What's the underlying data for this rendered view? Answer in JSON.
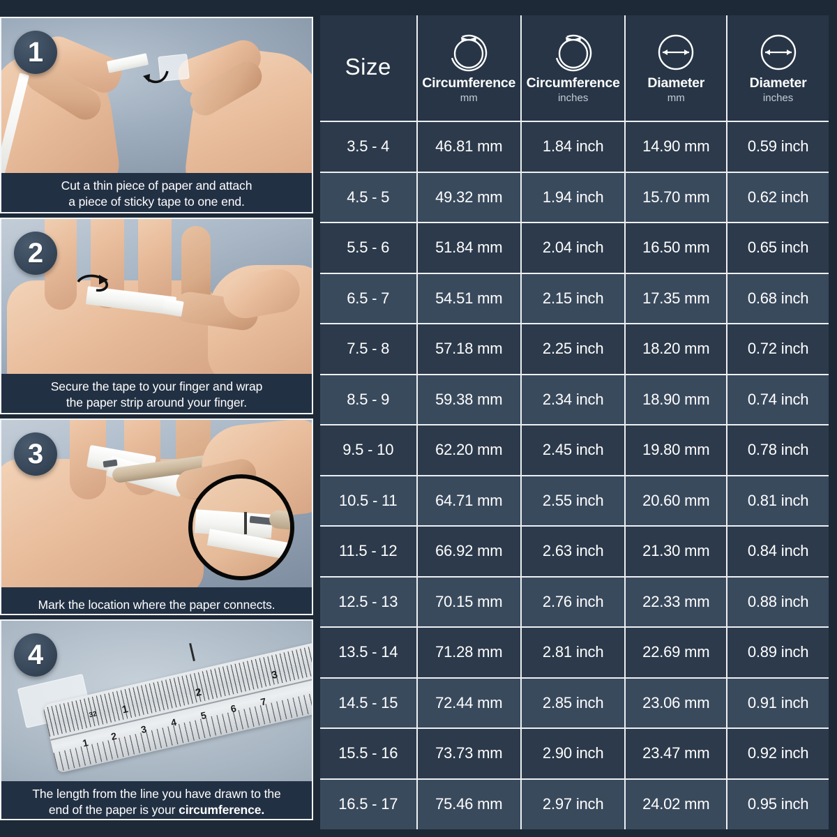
{
  "steps": [
    {
      "number": "1",
      "caption_lines": [
        "Cut a thin piece of paper and attach",
        "a piece of sticky tape to one end."
      ],
      "scene": "two-hands-paper-tape"
    },
    {
      "number": "2",
      "caption_lines": [
        "Secure the tape to your finger and wrap",
        "the paper strip around your finger."
      ],
      "scene": "hand-wrap-finger"
    },
    {
      "number": "3",
      "caption_lines": [
        "Mark the location where the paper connects."
      ],
      "scene": "pen-mark-magnifier"
    },
    {
      "number": "4",
      "caption_lines": [
        "The length from the line you have drawn to the",
        "end of the paper is your "
      ],
      "caption_bold": "circumference.",
      "scene": "ruler-measure"
    }
  ],
  "table": {
    "headers": [
      {
        "title": "Size",
        "unit": "",
        "icon": "none"
      },
      {
        "title": "Circumference",
        "unit": "mm",
        "icon": "circumference-ring-icon"
      },
      {
        "title": "Circumference",
        "unit": "inches",
        "icon": "circumference-ring-icon"
      },
      {
        "title": "Diameter",
        "unit": "mm",
        "icon": "diameter-arrow-icon"
      },
      {
        "title": "Diameter",
        "unit": "inches",
        "icon": "diameter-arrow-icon"
      }
    ],
    "rows": [
      [
        "3.5 - 4",
        "46.81 mm",
        "1.84 inch",
        "14.90 mm",
        "0.59 inch"
      ],
      [
        "4.5 - 5",
        "49.32 mm",
        "1.94 inch",
        "15.70 mm",
        "0.62 inch"
      ],
      [
        "5.5 - 6",
        "51.84 mm",
        "2.04 inch",
        "16.50 mm",
        "0.65 inch"
      ],
      [
        "6.5 - 7",
        "54.51 mm",
        "2.15 inch",
        "17.35 mm",
        "0.68 inch"
      ],
      [
        "7.5 - 8",
        "57.18 mm",
        "2.25 inch",
        "18.20 mm",
        "0.72 inch"
      ],
      [
        "8.5 - 9",
        "59.38 mm",
        "2.34 inch",
        "18.90 mm",
        "0.74 inch"
      ],
      [
        "9.5 - 10",
        "62.20 mm",
        "2.45 inch",
        "19.80 mm",
        "0.78 inch"
      ],
      [
        "10.5 - 11",
        "64.71 mm",
        "2.55 inch",
        "20.60 mm",
        "0.81 inch"
      ],
      [
        "11.5 - 12",
        "66.92 mm",
        "2.63 inch",
        "21.30 mm",
        "0.84 inch"
      ],
      [
        "12.5 - 13",
        "70.15 mm",
        "2.76 inch",
        "22.33 mm",
        "0.88 inch"
      ],
      [
        "13.5 - 14",
        "71.28 mm",
        "2.81 inch",
        "22.69 mm",
        "0.89 inch"
      ],
      [
        "14.5 - 15",
        "72.44 mm",
        "2.85 inch",
        "23.06 mm",
        "0.91 inch"
      ],
      [
        "15.5 - 16",
        "73.73 mm",
        "2.90 inch",
        "23.47 mm",
        "0.92 inch"
      ],
      [
        "16.5 - 17",
        "75.46 mm",
        "2.97 inch",
        "24.02 mm",
        "0.95 inch"
      ]
    ]
  },
  "ruler": {
    "top_scale_labels": [
      "32",
      "1",
      "2",
      "3"
    ],
    "bottom_scale_labels": [
      "1",
      "2",
      "3",
      "4",
      "5",
      "6",
      "7"
    ]
  },
  "colors": {
    "page_background": "#1d2937",
    "header_cell": "#273546",
    "row_dark": "#2c3a4b",
    "row_light": "#3a4a5d",
    "grid_line": "#eef1f4",
    "caption_background": "#223043",
    "badge_fill": "#39495b",
    "text": "#ffffff",
    "unit_text": "#c4ccd6"
  }
}
